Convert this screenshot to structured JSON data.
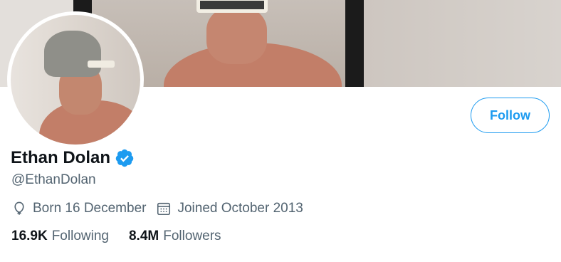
{
  "profile": {
    "name": "Ethan Dolan",
    "handle": "@EthanDolan",
    "verified": true,
    "birthday": "Born 16 December",
    "joined": "Joined October 2013"
  },
  "actions": {
    "follow_label": "Follow"
  },
  "stats": {
    "following_count": "16.9K",
    "following_label": "Following",
    "followers_count": "8.4M",
    "followers_label": "Followers"
  },
  "icons": {
    "verified": "verified-badge-icon",
    "birthday": "balloon-icon",
    "joined": "calendar-icon"
  },
  "colors": {
    "accent": "#1d9bf0",
    "text_primary": "#0f1419",
    "text_secondary": "#536471"
  }
}
